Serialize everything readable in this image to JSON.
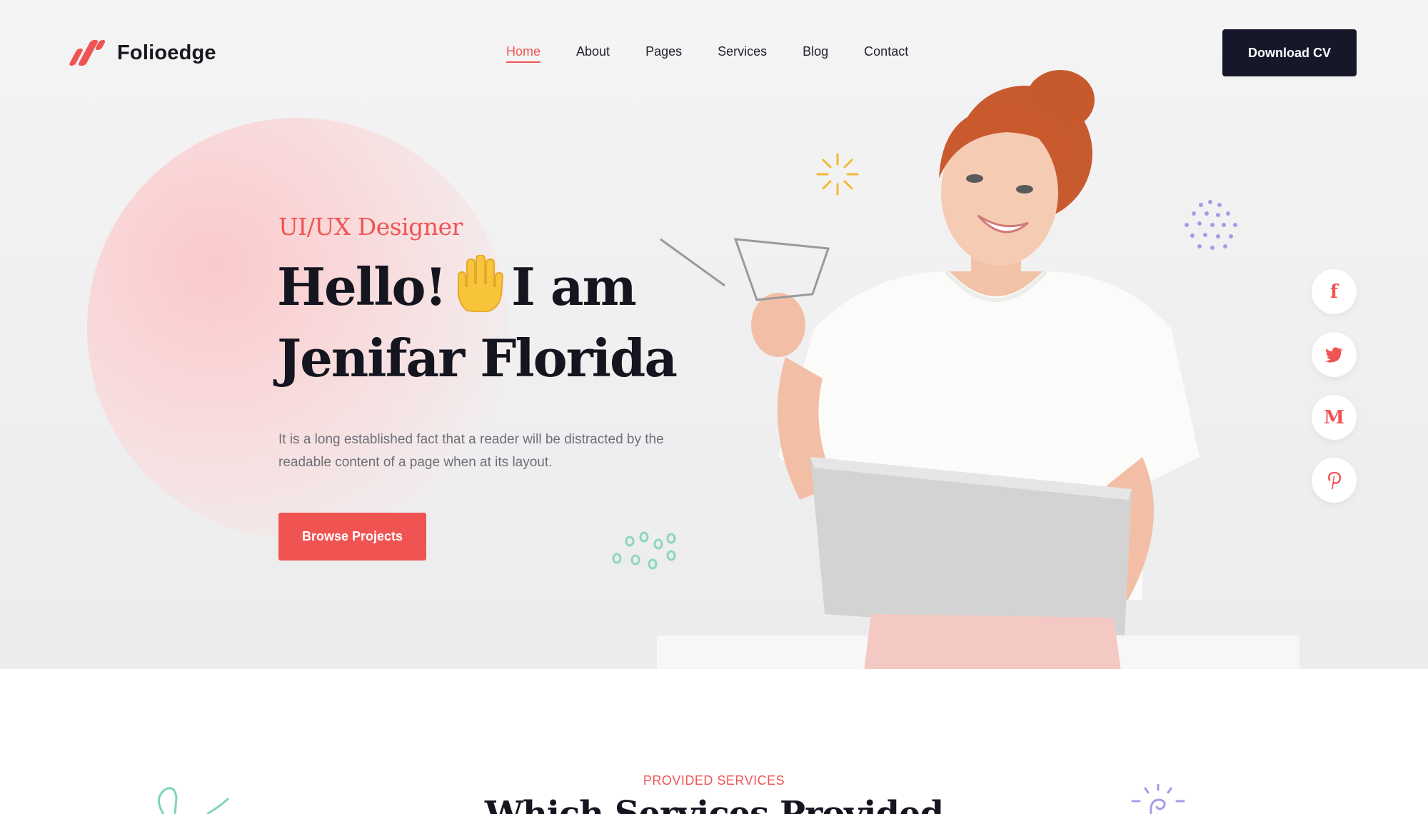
{
  "brand": {
    "name": "Folioedge",
    "accent": "#f05452",
    "dark": "#16182a"
  },
  "nav": {
    "items": [
      {
        "label": "Home",
        "active": true
      },
      {
        "label": "About"
      },
      {
        "label": "Pages"
      },
      {
        "label": "Services"
      },
      {
        "label": "Blog"
      },
      {
        "label": "Contact"
      }
    ]
  },
  "header": {
    "cta_label": "Download CV"
  },
  "hero": {
    "role": "UI/UX Designer",
    "headline_part1": "Hello!",
    "headline_emoji": "raised-hand-icon",
    "headline_part2": "I am",
    "headline_line2": "Jenifar Florida",
    "description": "It is a long established fact that a reader will be distracted by the readable content of a page when at its layout.",
    "button_label": "Browse Projects"
  },
  "social": [
    {
      "icon": "facebook-icon",
      "glyph": "f"
    },
    {
      "icon": "twitter-icon",
      "glyph": "🐦"
    },
    {
      "icon": "medium-icon",
      "glyph": "M"
    },
    {
      "icon": "pinterest-icon",
      "glyph": "P"
    }
  ],
  "services": {
    "subtitle": "PROVIDED SERVICES",
    "title": "Which Services Provided"
  }
}
